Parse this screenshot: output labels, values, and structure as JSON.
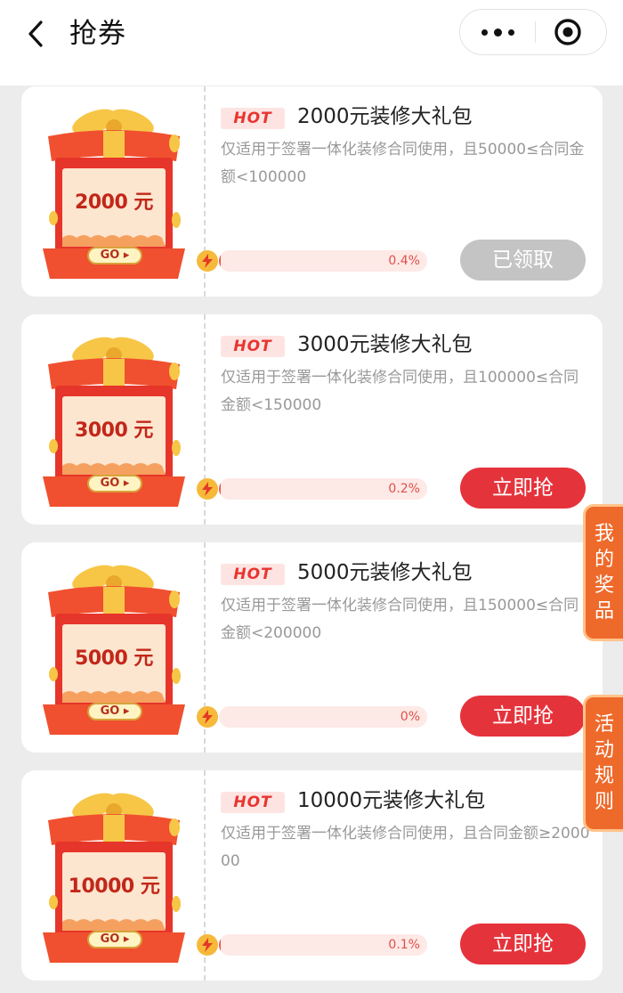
{
  "header": {
    "title": "抢券",
    "back_icon": "chevron-left-icon",
    "more_icon": "more-dots-icon",
    "close_icon": "target-close-icon"
  },
  "hot_label": "HOT",
  "go_label": "GO ▸",
  "coupons": [
    {
      "amount": "2000 元",
      "title": "2000元装修大礼包",
      "desc": "仅适用于签署一体化装修合同使用，且50000≤合同金额<100000",
      "progress": "0.4%",
      "progress_value": 0.4,
      "button": "已领取",
      "button_state": "disabled"
    },
    {
      "amount": "3000 元",
      "title": "3000元装修大礼包",
      "desc": "仅适用于签署一体化装修合同使用，且100000≤合同金额<150000",
      "progress": "0.2%",
      "progress_value": 0.2,
      "button": "立即抢",
      "button_state": "active"
    },
    {
      "amount": "5000 元",
      "title": "5000元装修大礼包",
      "desc": "仅适用于签署一体化装修合同使用，且150000≤合同金额<200000",
      "progress": "0%",
      "progress_value": 0,
      "button": "立即抢",
      "button_state": "active"
    },
    {
      "amount": "10000 元",
      "title": "10000元装修大礼包",
      "desc": "仅适用于签署一体化装修合同使用，且合同金额≥200000",
      "progress": "0.1%",
      "progress_value": 0.1,
      "button": "立即抢",
      "button_state": "active"
    }
  ],
  "side_tabs": {
    "prizes": "我的奖品",
    "rules": "活动规则"
  },
  "colors": {
    "accent": "#e5333c",
    "disabled": "#c4c4c4",
    "side_tab": "#ee6a2b"
  }
}
